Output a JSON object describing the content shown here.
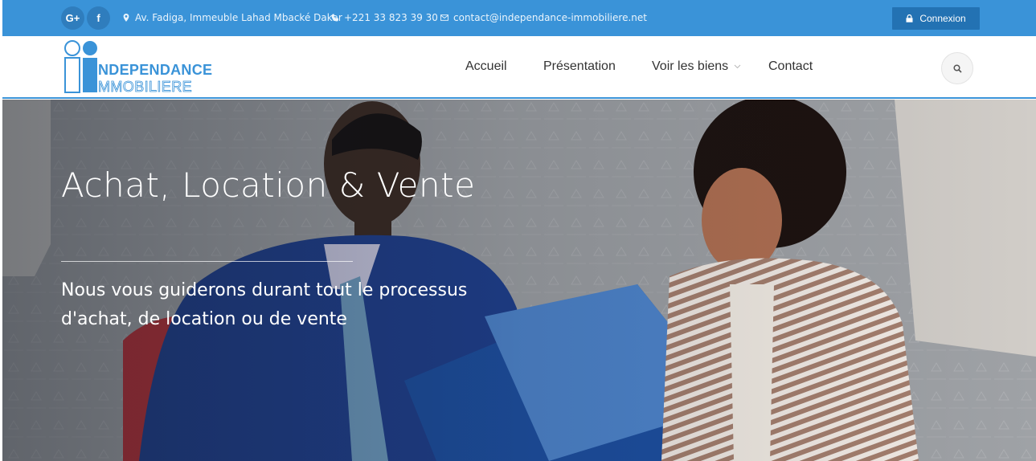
{
  "topbar": {
    "social": [
      {
        "name": "google-plus-icon",
        "label": "G+"
      },
      {
        "name": "facebook-icon",
        "label": "f"
      }
    ],
    "address": "Av. Fadiga, Immeuble Lahad Mbacké Dakar",
    "phone": "+221 33 823 39 30",
    "email": "contact@independance-immobiliere.net",
    "login_label": "Connexion"
  },
  "navbar": {
    "logo_line1": "NDEPENDANCE",
    "logo_line2": "MMOBILIERE",
    "items": [
      {
        "label": "Accueil"
      },
      {
        "label": "Présentation"
      },
      {
        "label": "Voir les biens"
      },
      {
        "label": "Contact"
      }
    ]
  },
  "hero": {
    "title": "Achat, Location & Vente",
    "subtitle": "Nous vous guiderons durant tout le processus d'achat, de location ou de vente"
  },
  "colors": {
    "accent": "#3a93d8",
    "button": "#2372b3"
  }
}
